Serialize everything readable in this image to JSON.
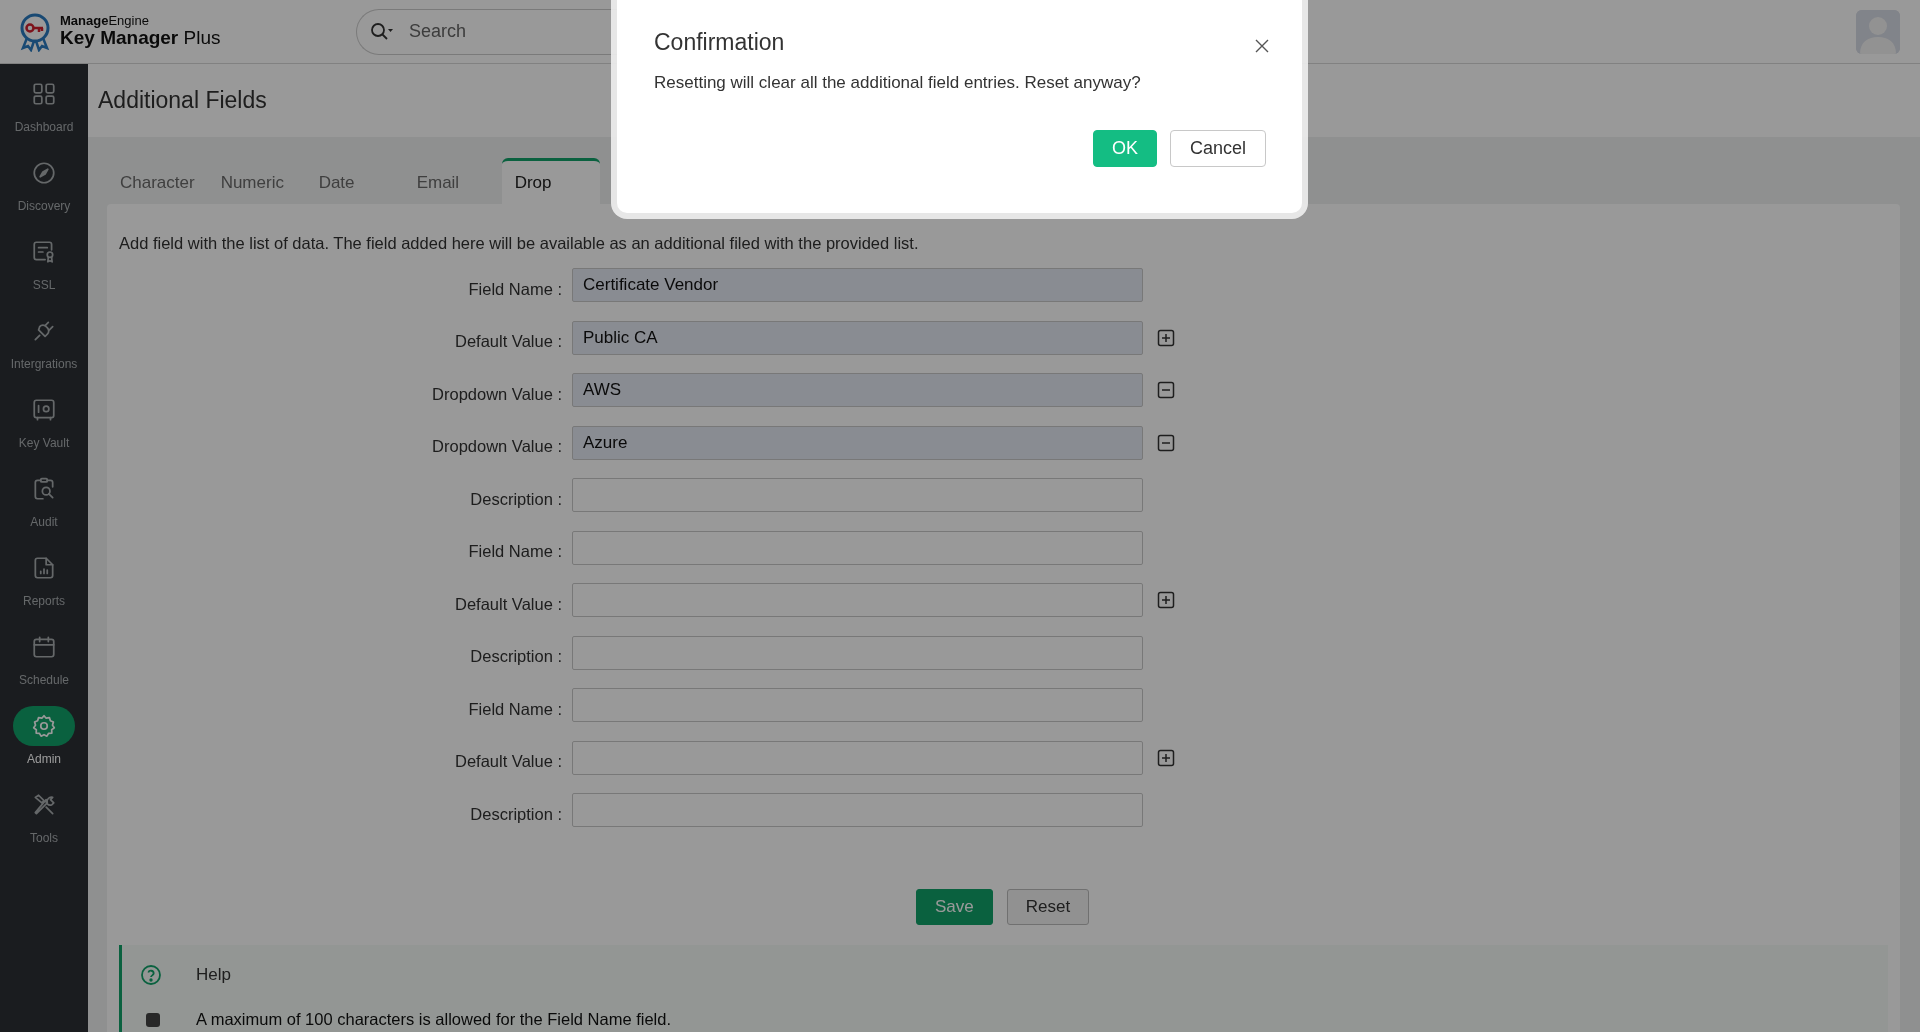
{
  "header": {
    "brand_top": "**Manage**Engine",
    "brand_name": "**Key Manager** Plus",
    "search": {
      "placeholder": "Search"
    }
  },
  "sidebar": {
    "items": [
      {
        "label": "Dashboard",
        "selected": false
      },
      {
        "label": "Discovery",
        "selected": false
      },
      {
        "label": "SSL",
        "selected": false
      },
      {
        "label": "Intergrations",
        "selected": false
      },
      {
        "label": "Key Vault",
        "selected": false
      },
      {
        "label": "Audit",
        "selected": false
      },
      {
        "label": "Reports",
        "selected": false
      },
      {
        "label": "Schedule",
        "selected": false
      },
      {
        "label": "Admin",
        "selected": true
      },
      {
        "label": "Tools",
        "selected": false
      }
    ]
  },
  "page": {
    "title": "Additional Fields",
    "tabs": [
      {
        "label": "Character",
        "selected": false
      },
      {
        "label": "Numeric",
        "selected": false
      },
      {
        "label": "Date",
        "selected": false
      },
      {
        "label": "Email",
        "selected": false
      },
      {
        "label": "Drop",
        "selected": true
      }
    ],
    "description": "Add field with the list of data. The field added here will be available as an additional filed with the provided list.",
    "rows": [
      {
        "label": "Field Name :",
        "value": "Certificate Vendor",
        "kind": "plain"
      },
      {
        "label": "Default Value :",
        "value": "Public CA",
        "kind": "addable"
      },
      {
        "label": "Dropdown Value :",
        "value": "AWS",
        "kind": "removable"
      },
      {
        "label": "Dropdown Value :",
        "value": "Azure",
        "kind": "removable"
      },
      {
        "label": "Description :",
        "kind": "plain"
      },
      {
        "label": "Field Name :",
        "kind": "plain"
      },
      {
        "label": "Default Value :",
        "kind": "addable"
      },
      {
        "label": "Description :",
        "kind": "plain"
      },
      {
        "label": "Field Name :",
        "kind": "plain"
      },
      {
        "label": "Default Value :",
        "kind": "addable"
      },
      {
        "label": "Description :",
        "kind": "plain"
      }
    ],
    "buttons": [
      {
        "label": "Save",
        "kind": "primary"
      },
      {
        "label": "Reset",
        "kind": "secondary"
      }
    ],
    "help": {
      "title": "Help",
      "items": [
        "A maximum of 100 characters is allowed for the Field Name field."
      ]
    }
  },
  "dialog": {
    "title": "Confirmation",
    "message": "Resetting will clear all the additional field entries. Reset anyway?",
    "buttons": [
      {
        "label": "OK",
        "kind": "primary"
      },
      {
        "label": "Cancel",
        "kind": "secondary"
      }
    ]
  }
}
